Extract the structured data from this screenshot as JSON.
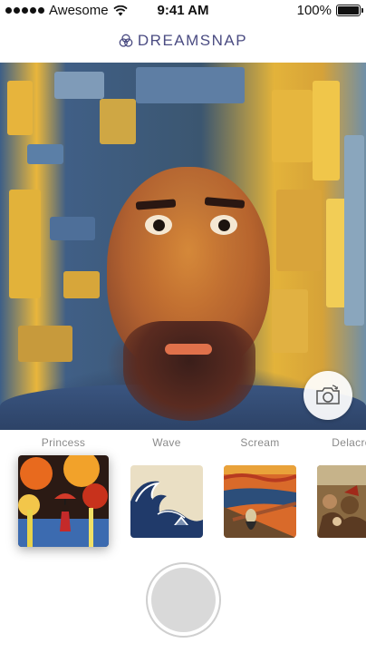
{
  "status_bar": {
    "carrier": "Awesome",
    "time": "9:41 AM",
    "battery_percent": "100%",
    "battery_level": 1.0,
    "signal_dots": 5,
    "wifi_icon": "wifi-icon"
  },
  "header": {
    "logo_text": "DREAMSNAP",
    "logo_icon": "dreamsnap-logo-icon",
    "accent_color": "#4b4c82"
  },
  "camera": {
    "flip_icon": "camera-flip-icon"
  },
  "filters": {
    "items": [
      {
        "label": "Princess",
        "selected": true
      },
      {
        "label": "Wave",
        "selected": false
      },
      {
        "label": "Scream",
        "selected": false
      },
      {
        "label": "Delacro",
        "selected": false
      }
    ]
  },
  "capture": {
    "icon": "shutter-button"
  }
}
